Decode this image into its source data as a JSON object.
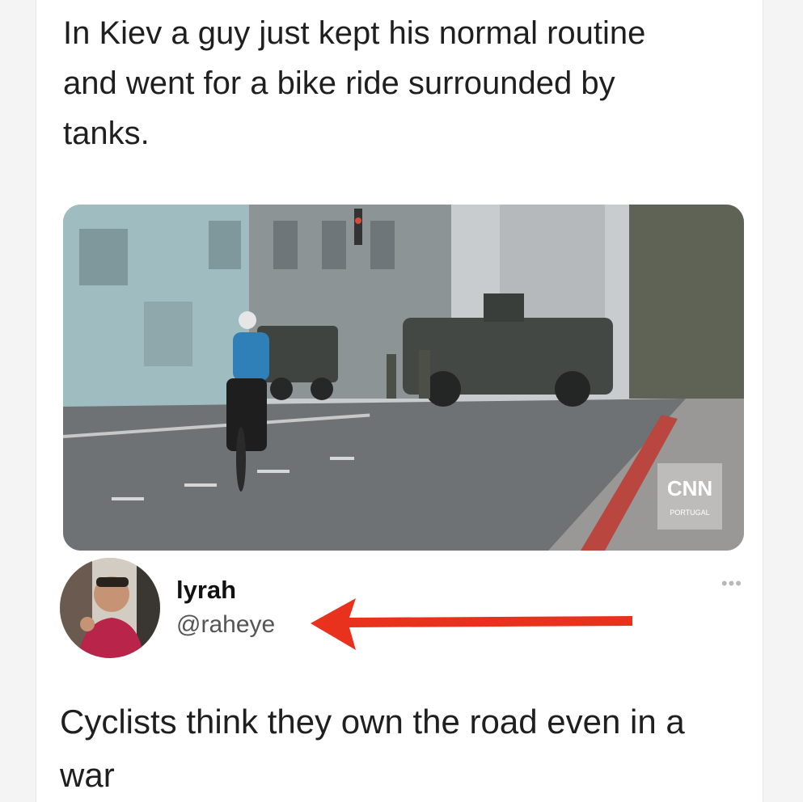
{
  "post": {
    "text": "In Kiev a guy just kept his normal routine and went for a bike ride surrounded by tanks.",
    "media": {
      "watermark_main": "CNN",
      "watermark_sub": "PORTUGAL"
    }
  },
  "author": {
    "display_name": "lyrah",
    "handle": "@raheye",
    "more_icon": "ellipsis-icon"
  },
  "annotation": {
    "arrow_color": "#e8321e",
    "arrow_icon": "arrow-left-icon"
  },
  "reply": {
    "text": "Cyclists think they own the road even in a war"
  }
}
